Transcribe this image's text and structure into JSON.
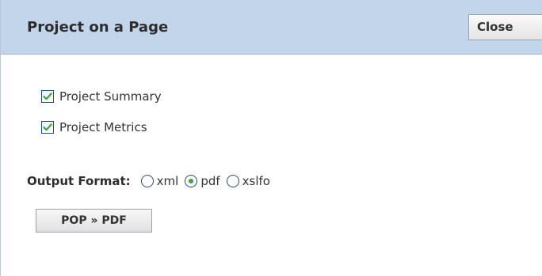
{
  "dialog": {
    "title": "Project on a Page",
    "close_label": "Close"
  },
  "options": [
    {
      "label": "Project Summary",
      "checked": true
    },
    {
      "label": "Project Metrics",
      "checked": true
    }
  ],
  "output_format": {
    "label": "Output Format:",
    "choices": [
      {
        "label": "xml",
        "selected": false
      },
      {
        "label": "pdf",
        "selected": true
      },
      {
        "label": "xslfo",
        "selected": false
      }
    ]
  },
  "action": {
    "label": "POP » PDF"
  },
  "colors": {
    "header_bg": "#c3d5eb",
    "check_mark": "#3aa53a",
    "radio_dot": "#3aa53a"
  }
}
